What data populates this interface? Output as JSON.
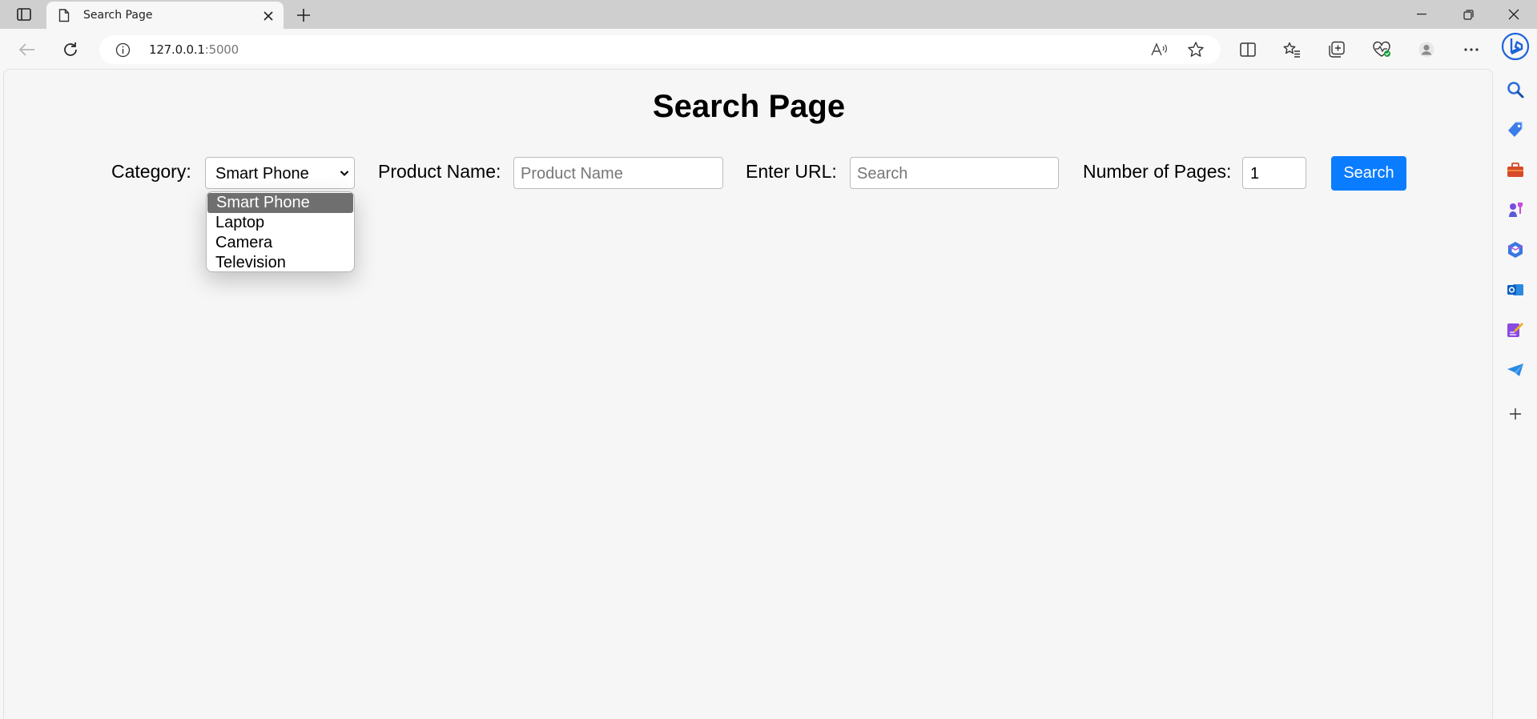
{
  "browser": {
    "tab": {
      "title": "Search Page"
    },
    "address": {
      "host": "127.0.0.1",
      "port": ":5000"
    }
  },
  "page": {
    "title": "Search Page",
    "form": {
      "category_label": "Category:",
      "category_selected": "Smart Phone",
      "category_options": [
        "Smart Phone",
        "Laptop",
        "Camera",
        "Television"
      ],
      "product_label": "Product Name:",
      "product_placeholder": "Product Name",
      "url_label": "Enter URL:",
      "url_placeholder": "Search",
      "pages_label": "Number of Pages:",
      "pages_value": "1",
      "search_button": "Search"
    }
  },
  "colors": {
    "accent": "#0a7cff",
    "selected_option": "#6f6f6f"
  }
}
